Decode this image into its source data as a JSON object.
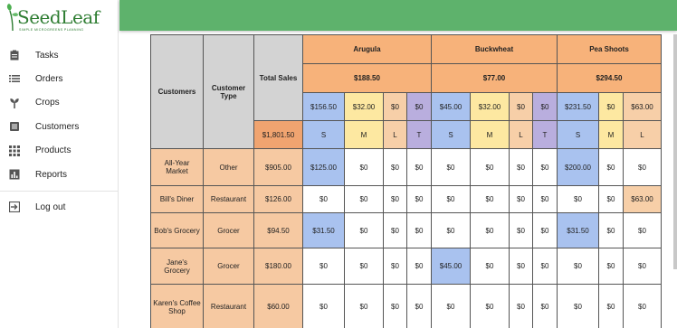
{
  "brand": {
    "name": "SeedLeaf",
    "tagline": "SIMPLE MICROGREENS PLANNING"
  },
  "sidebar": {
    "items": [
      {
        "label": "Tasks",
        "icon": "clipboard-icon"
      },
      {
        "label": "Orders",
        "icon": "list-icon"
      },
      {
        "label": "Crops",
        "icon": "seedling-icon"
      },
      {
        "label": "Customers",
        "icon": "contacts-icon"
      },
      {
        "label": "Products",
        "icon": "grid-icon"
      },
      {
        "label": "Reports",
        "icon": "bar-chart-icon"
      }
    ],
    "logout": {
      "label": "Log out",
      "icon": "logout-icon"
    }
  },
  "colors": {
    "topbar": "#5eb26c",
    "brand": "#2e7d32",
    "blue": "#a9c2ef",
    "yellow": "#fde8a1",
    "tan": "#f7cfa8",
    "purple": "#b9aede",
    "orange": "#f7b27a"
  },
  "table": {
    "col_customers": "Customers",
    "col_type": "Customer Type",
    "col_total": "Total Sales",
    "grand_total": "$1,801.50",
    "crops": [
      {
        "name": "Arugula",
        "total": "$188.50",
        "sizes": [
          "$156.50",
          "$32.00",
          "$0",
          "$0"
        ]
      },
      {
        "name": "Buckwheat",
        "total": "$77.00",
        "sizes": [
          "$45.00",
          "$32.00",
          "$0",
          "$0"
        ]
      },
      {
        "name": "Pea Shoots",
        "total": "$294.50",
        "sizes": [
          "$231.50",
          "$0",
          "$63.00"
        ]
      }
    ],
    "size_labels": [
      "S",
      "M",
      "L",
      "T"
    ],
    "rows": [
      {
        "name": "All-Year Market",
        "type": "Other",
        "total": "$905.00",
        "cells": [
          "$125.00",
          "$0",
          "$0",
          "$0",
          "$0",
          "$0",
          "$0",
          "$0",
          "$200.00",
          "$0",
          "$0"
        ]
      },
      {
        "name": "Bill's Diner",
        "type": "Restaurant",
        "total": "$126.00",
        "cells": [
          "$0",
          "$0",
          "$0",
          "$0",
          "$0",
          "$0",
          "$0",
          "$0",
          "$0",
          "$0",
          "$63.00"
        ]
      },
      {
        "name": "Bob's Grocery",
        "type": "Grocer",
        "total": "$94.50",
        "cells": [
          "$31.50",
          "$0",
          "$0",
          "$0",
          "$0",
          "$0",
          "$0",
          "$0",
          "$31.50",
          "$0",
          "$0"
        ]
      },
      {
        "name": "Jane's Grocery",
        "type": "Grocer",
        "total": "$180.00",
        "cells": [
          "$0",
          "$0",
          "$0",
          "$0",
          "$45.00",
          "$0",
          "$0",
          "$0",
          "$0",
          "$0",
          "$0"
        ]
      },
      {
        "name": "Karen's Coffee Shop",
        "type": "Restaurant",
        "total": "$60.00",
        "cells": [
          "$0",
          "$0",
          "$0",
          "$0",
          "$0",
          "$0",
          "$0",
          "$0",
          "$0",
          "$0",
          "$0"
        ]
      }
    ]
  }
}
